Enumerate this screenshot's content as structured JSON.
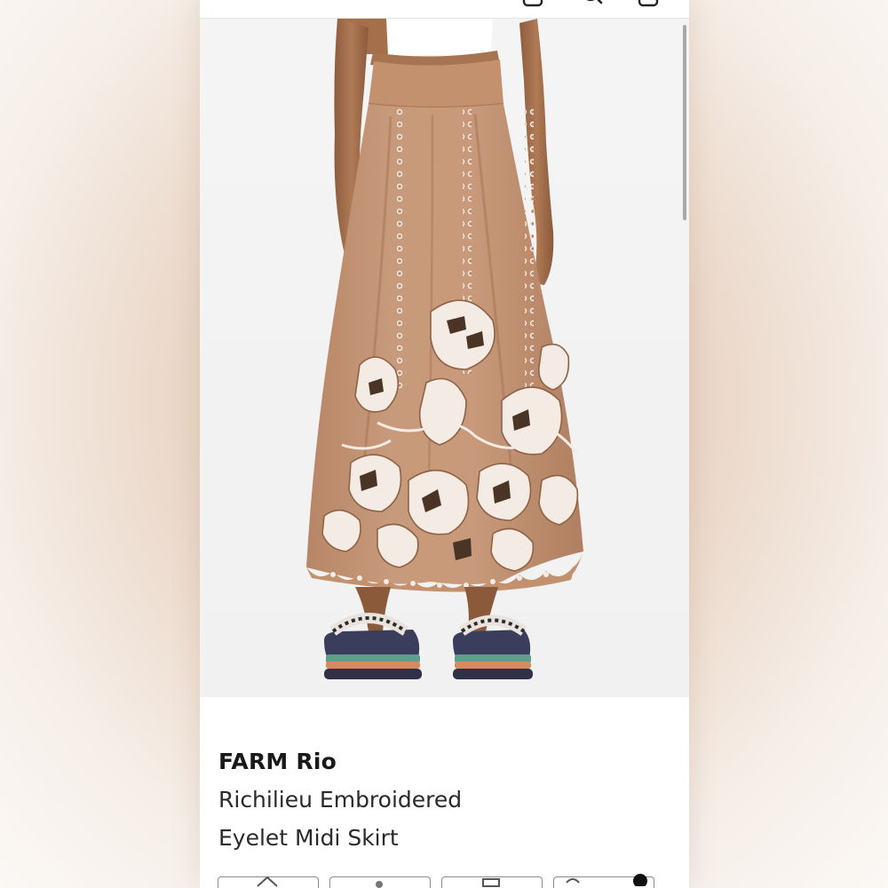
{
  "product": {
    "brand": "FARM Rio",
    "name_line_1": "Richilieu Embroidered",
    "name_line_2": "Eyelet Midi Skirt"
  },
  "icons": {
    "top": [
      "share-icon",
      "search-icon",
      "bag-icon"
    ],
    "bottom": [
      "home-icon",
      "tab-icon",
      "list-icon",
      "heart-icon",
      "account-icon"
    ]
  },
  "colors": {
    "skirt": "#c39474",
    "skirt_shadow": "#a7775a",
    "embroidery": "#f4ece4",
    "background": "#f1f1f1",
    "text": "#1a1a1a"
  }
}
